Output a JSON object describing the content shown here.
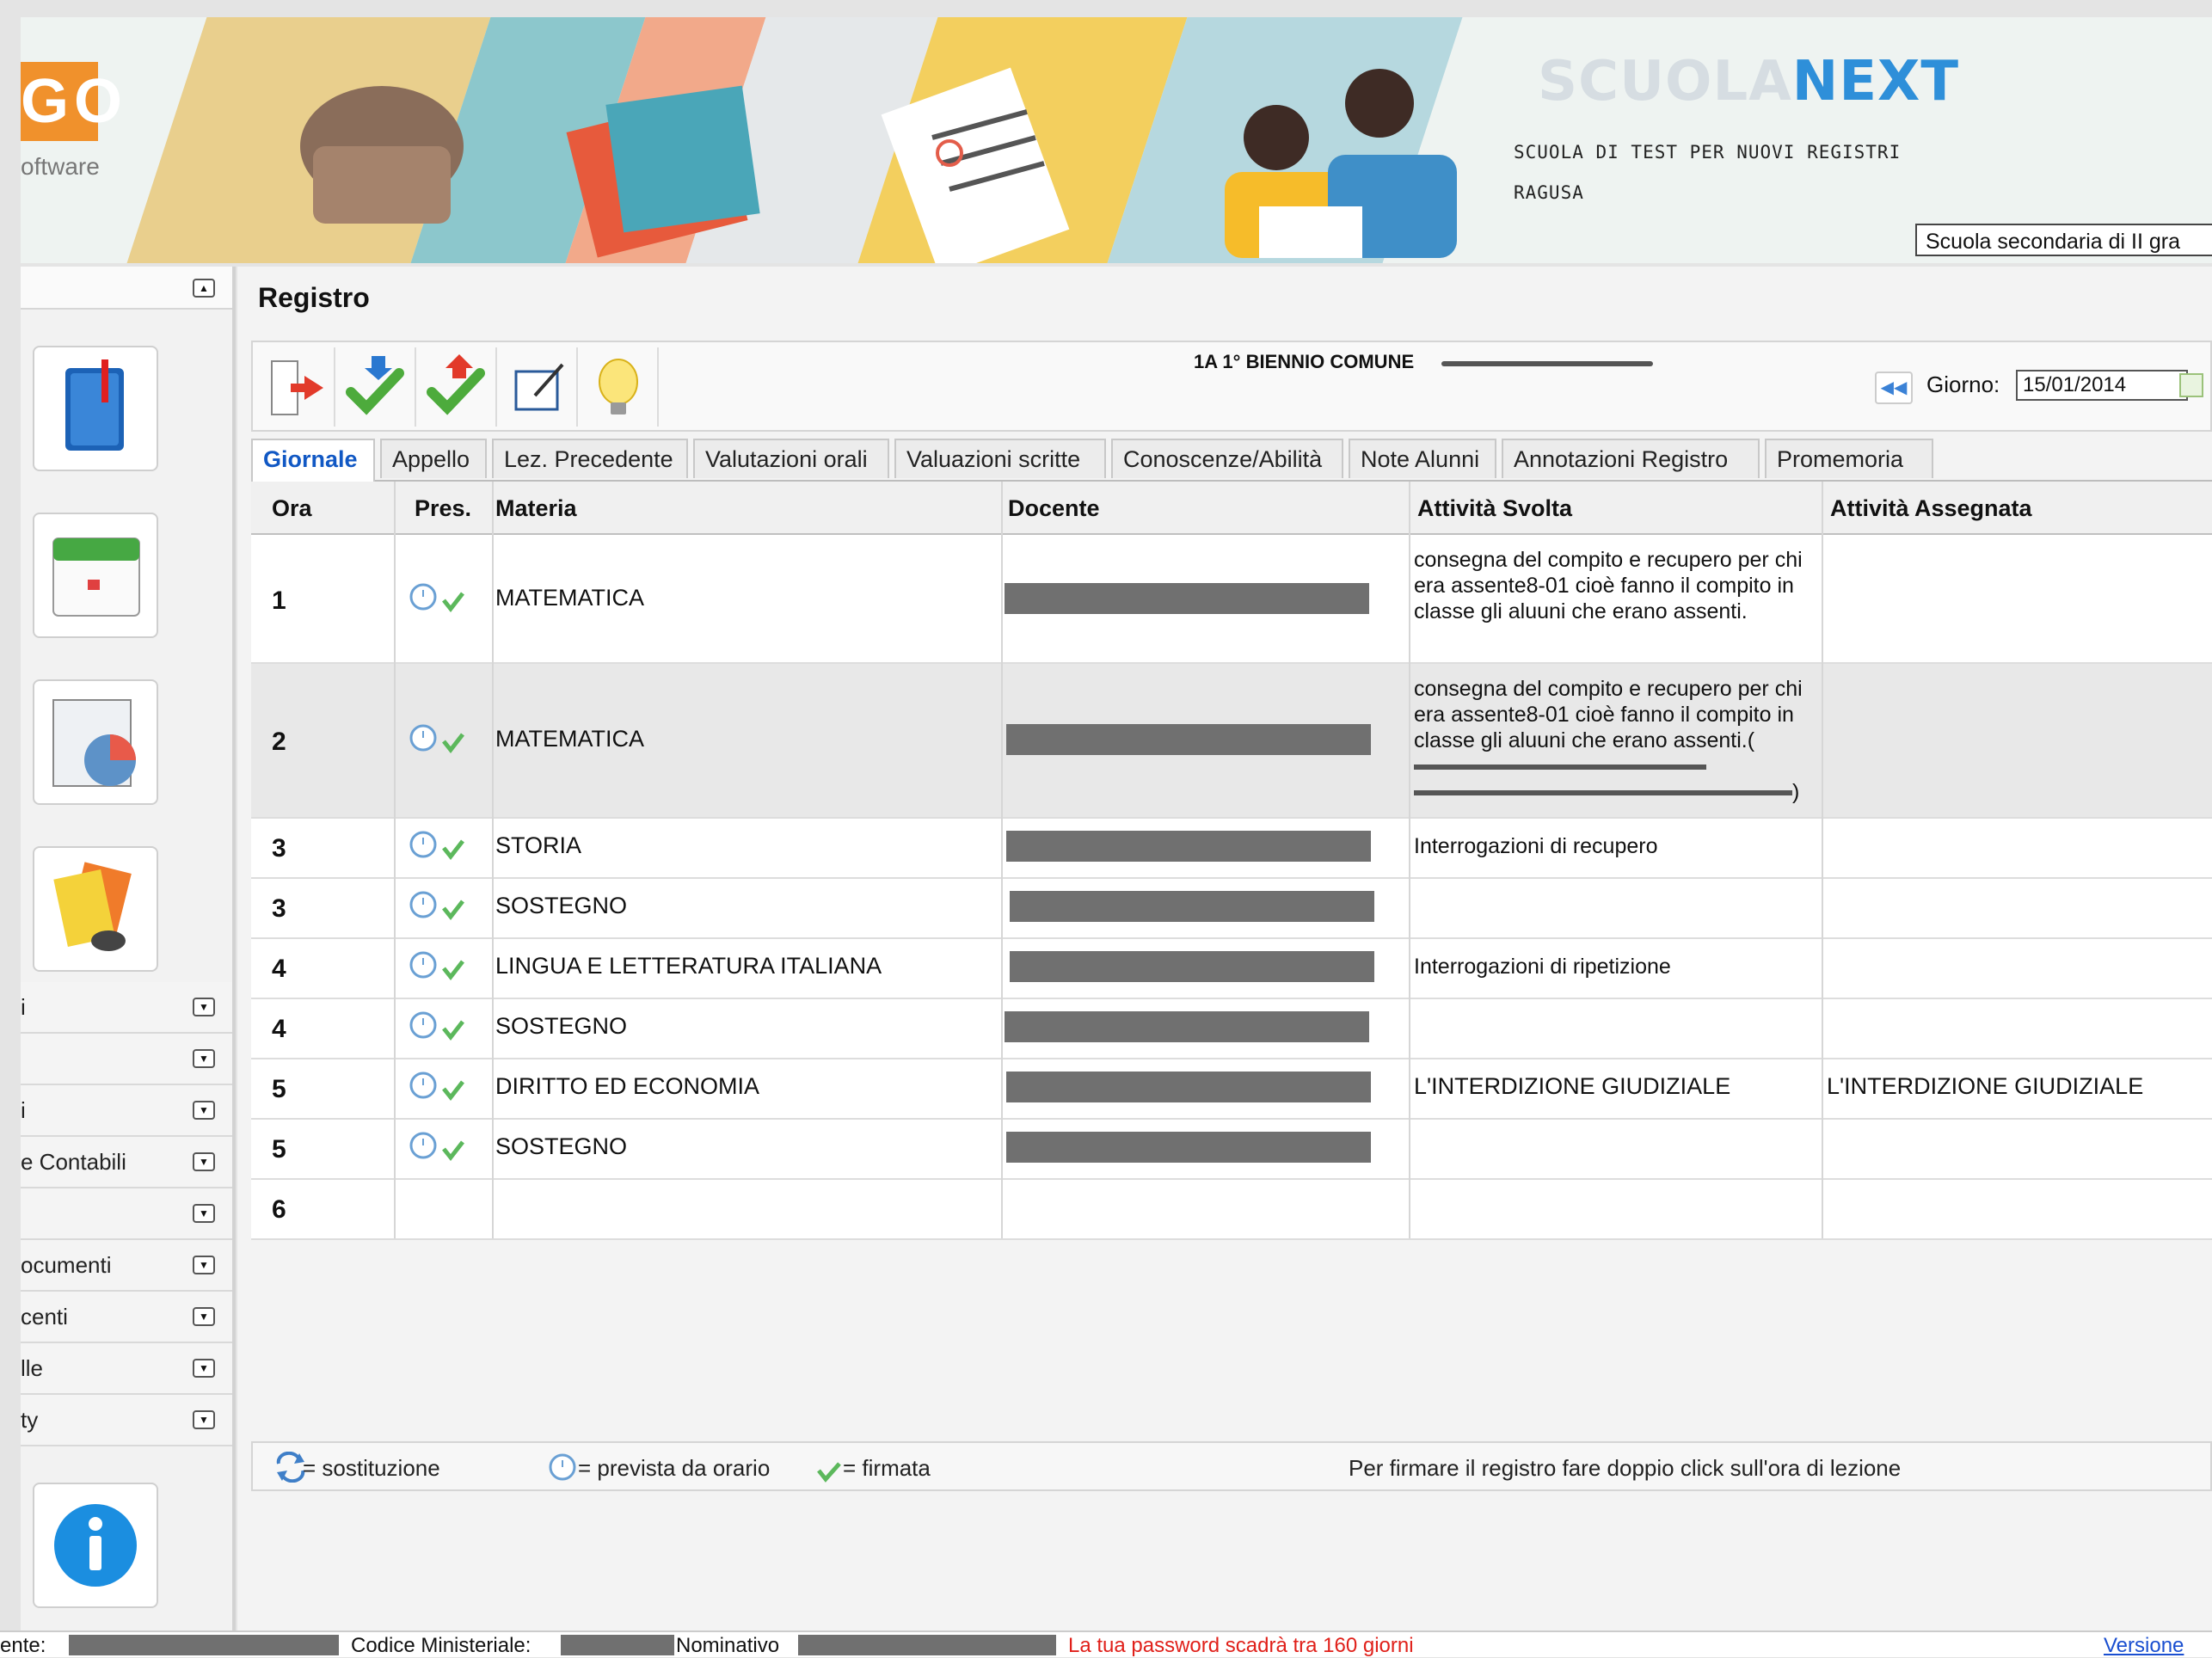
{
  "header": {
    "logo_text": "GO",
    "logo_subtitle": "oftware",
    "brand_part1": "SCUOLA",
    "brand_part2": "NEXT",
    "school_name": "SCUOLA DI TEST PER NUOVI REGISTRI",
    "school_city": "RAGUSA",
    "school_type_selected": "Scuola secondaria di II gra"
  },
  "sidebar": {
    "menus": [
      "i",
      "",
      "i",
      "e Contabili",
      "",
      "ocumenti",
      "centi",
      "lle",
      "ty"
    ]
  },
  "main": {
    "panel_title": "Registro",
    "class_title": "1A 1° BIENNIO COMUNE",
    "giorno_label": "Giorno:",
    "giorno_value": "15/01/2014",
    "tabs": [
      "Giornale",
      "Appello",
      "Lez. Precedente",
      "Valutazioni orali",
      "Valuazioni scritte",
      "Conoscenze/Abilità",
      "Note Alunni",
      "Annotazioni Registro",
      "Promemoria"
    ],
    "columns": {
      "ora": "Ora",
      "pres": "Pres.",
      "materia": "Materia",
      "docente": "Docente",
      "svolta": "Attività Svolta",
      "assegnata": "Attività Assegnata"
    },
    "rows": [
      {
        "ora": "1",
        "materia": "MATEMATICA",
        "svolta": "consegna del compito e recupero per chi era assente8-01 cioè fanno il compito in classe gli aluuni che erano assenti.",
        "assegnata": ""
      },
      {
        "ora": "2",
        "materia": "MATEMATICA",
        "svolta": "consegna del compito e recupero per chi era assente8-01 cioè fanno il compito in classe gli aluuni che erano assenti.(",
        "svolta_tail": ")",
        "assegnata": ""
      },
      {
        "ora": "3",
        "materia": "STORIA",
        "svolta": "Interrogazioni di recupero",
        "assegnata": ""
      },
      {
        "ora": "3",
        "materia": "SOSTEGNO",
        "svolta": "",
        "assegnata": ""
      },
      {
        "ora": "4",
        "materia": "LINGUA E LETTERATURA ITALIANA",
        "svolta": "Interrogazioni di ripetizione",
        "assegnata": ""
      },
      {
        "ora": "4",
        "materia": "SOSTEGNO",
        "svolta": "",
        "assegnata": ""
      },
      {
        "ora": "5",
        "materia": "DIRITTO ED ECONOMIA",
        "svolta": "L'INTERDIZIONE GIUDIZIALE",
        "assegnata": "L'INTERDIZIONE GIUDIZIALE"
      },
      {
        "ora": "5",
        "materia": "SOSTEGNO",
        "svolta": "",
        "assegnata": ""
      },
      {
        "ora": "6",
        "materia": "",
        "svolta": "",
        "assegnata": ""
      }
    ],
    "legend": {
      "sostituzione": "= sostituzione",
      "prevista": "= prevista da orario",
      "firmata": "= firmata",
      "hint": "Per firmare il registro fare doppio click sull'ora di lezione"
    }
  },
  "status": {
    "ente_label": "ente:",
    "codice_label": "Codice Ministeriale:",
    "nominativo_label": "Nominativo",
    "password_msg": "La tua password scadrà tra 160 giorni",
    "versione": "Versione"
  },
  "colors": {
    "accent_blue": "#1158c4",
    "brand_blue": "#2e8fd9",
    "warning_red": "#e0201a",
    "check_green": "#5cb85c"
  }
}
